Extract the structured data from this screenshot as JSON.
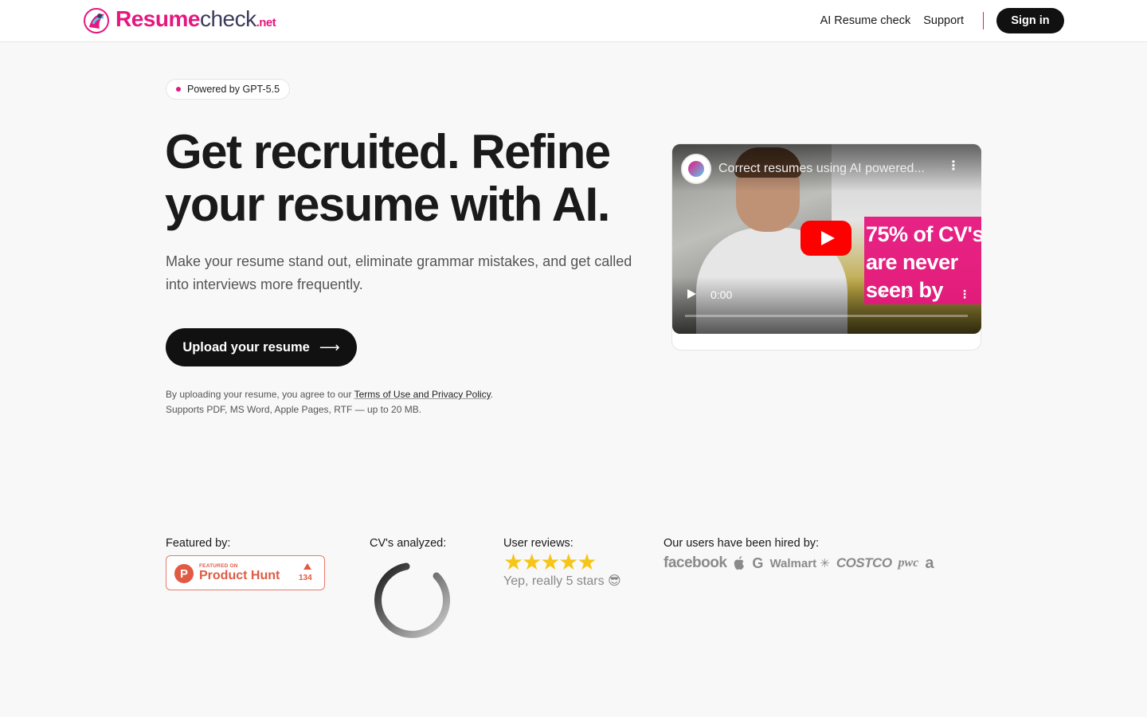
{
  "header": {
    "logo": {
      "resume": "Resume",
      "check": "check",
      "net": ".net"
    },
    "nav": {
      "ai_resume_check": "AI Resume check",
      "support": "Support",
      "sign_in": "Sign in"
    }
  },
  "hero": {
    "badge": "Powered by GPT-5.5",
    "headline": "Get recruited. Refine your resume with AI.",
    "subheadline": "Make your resume stand out, eliminate grammar mistakes, and get called into interviews more frequently.",
    "upload_button": "Upload your resume",
    "legal_prefix": "By uploading your resume, you agree to our ",
    "legal_link": "Terms of Use and Privacy Policy",
    "legal_suffix": ".",
    "formats": "Supports PDF, MS Word, Apple Pages, RTF — up to 20 MB."
  },
  "video": {
    "title": "Correct resumes using AI powered...",
    "overlay_text": "75% of CV's\nare never\nseen by",
    "time": "0:00"
  },
  "stats": {
    "featured_label": "Featured by:",
    "product_hunt": {
      "featured_on": "FEATURED ON",
      "name": "Product Hunt",
      "count": "134",
      "letter": "P"
    },
    "cvs_label": "CV's analyzed:",
    "reviews_label": "User reviews:",
    "stars": "★★★★★",
    "review_text": "Yep, really 5 stars 😎",
    "hired_label": "Our users have been hired by:",
    "companies": {
      "facebook": "facebook",
      "google": "G",
      "walmart": "Walmart",
      "costco": "COSTCO",
      "pwc": "pwc",
      "amazon": "a"
    }
  },
  "colors": {
    "brand_pink": "#e6177f",
    "dark": "#111111",
    "product_hunt": "#e05a44",
    "star": "#f5c518"
  }
}
